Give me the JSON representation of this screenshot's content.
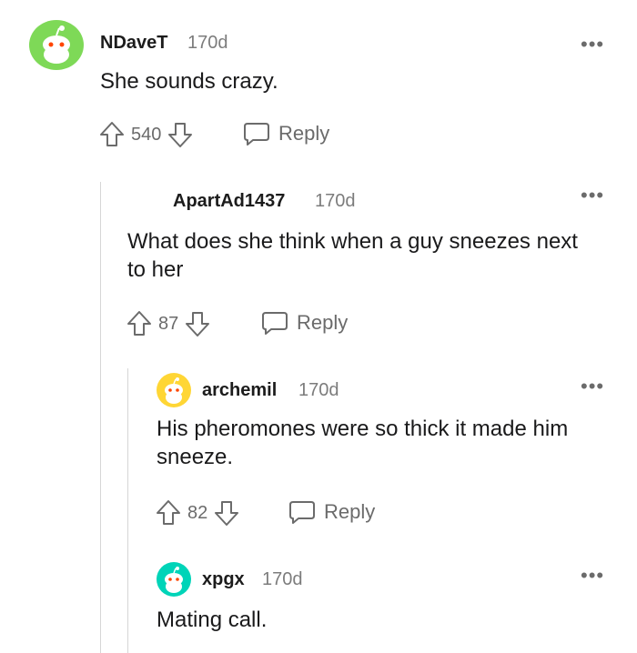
{
  "comments": [
    {
      "author": "NDaveT",
      "age": "170d",
      "body": "She sounds crazy.",
      "score": "540",
      "reply_label": "Reply",
      "avatar_color": "#7ed957"
    },
    {
      "author": "ApartAd1437",
      "age": "170d",
      "body": "What does she think when a guy sneezes next to her",
      "score": "87",
      "reply_label": "Reply",
      "avatar_color": ""
    },
    {
      "author": "archemil",
      "age": "170d",
      "body": "His pheromones were so thick it made him sneeze.",
      "score": "82",
      "reply_label": "Reply",
      "avatar_color": "#ffd635"
    },
    {
      "author": "xpgx",
      "age": "170d",
      "body": "Mating call.",
      "score": "",
      "reply_label": "",
      "avatar_color": "#00d4b8"
    }
  ],
  "more_options_label": "•••",
  "icons": {
    "upvote": "upvote-icon",
    "downvote": "downvote-icon",
    "reply": "reply-bubble-icon",
    "more": "more-options-icon"
  },
  "colors": {
    "meta_gray": "#7c7c7c",
    "thread_line": "#d6d6d6"
  }
}
